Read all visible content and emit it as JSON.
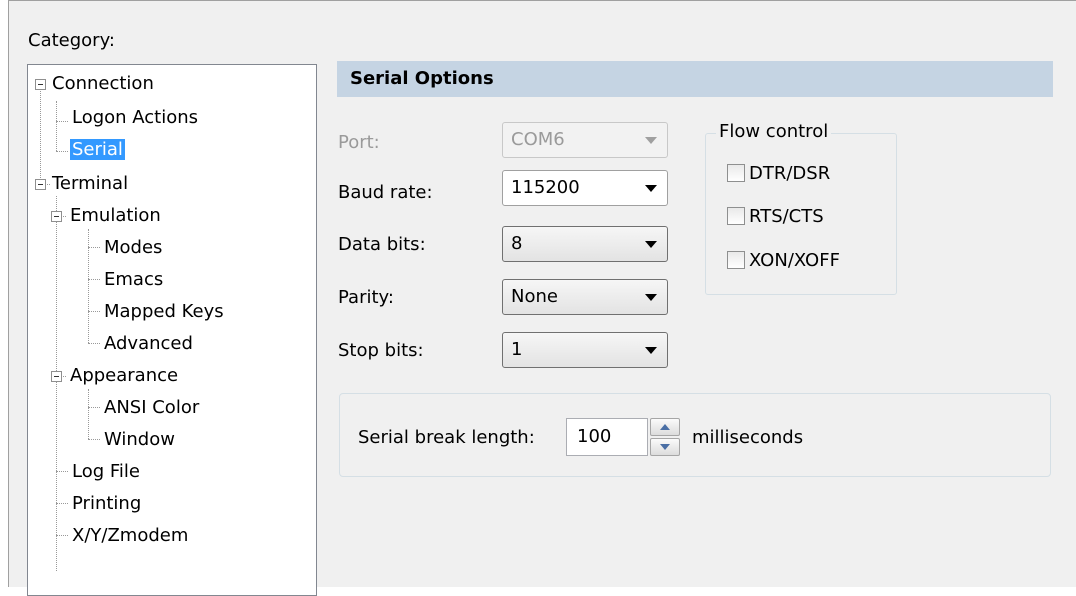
{
  "category_label": "Category:",
  "tree": {
    "items": [
      {
        "label": "Connection"
      },
      {
        "label": "Logon Actions"
      },
      {
        "label": "Serial"
      },
      {
        "label": "Terminal"
      },
      {
        "label": "Emulation"
      },
      {
        "label": "Modes"
      },
      {
        "label": "Emacs"
      },
      {
        "label": "Mapped Keys"
      },
      {
        "label": "Advanced"
      },
      {
        "label": "Appearance"
      },
      {
        "label": "ANSI Color"
      },
      {
        "label": "Window"
      },
      {
        "label": "Log File"
      },
      {
        "label": "Printing"
      },
      {
        "label": "X/Y/Zmodem"
      }
    ],
    "selected": "Serial"
  },
  "serial_options": {
    "title": "Serial Options",
    "port": {
      "label": "Port:",
      "value": "COM6"
    },
    "baud_rate": {
      "label": "Baud rate:",
      "value": "115200"
    },
    "data_bits": {
      "label": "Data bits:",
      "value": "8"
    },
    "parity": {
      "label": "Parity:",
      "value": "None"
    },
    "stop_bits": {
      "label": "Stop bits:",
      "value": "1"
    },
    "flow_control": {
      "title": "Flow control",
      "options": [
        {
          "label": "DTR/DSR",
          "checked": false
        },
        {
          "label": "RTS/CTS",
          "checked": false
        },
        {
          "label": "XON/XOFF",
          "checked": false
        }
      ]
    },
    "break": {
      "label": "Serial break length:",
      "value": "100",
      "unit": "milliseconds"
    }
  },
  "colors": {
    "header_bg": "#c5d4e3",
    "selection": "#3399ff",
    "dialog_bg": "#f0f0f0"
  }
}
